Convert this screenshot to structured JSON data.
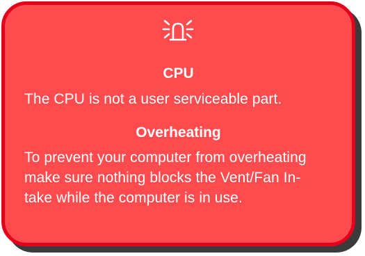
{
  "icon": "alarm-bell-icon",
  "colors": {
    "box_fill": "#ff4a4e",
    "box_border": "#e4001b",
    "shadow": "#3b3b3b",
    "text": "#ffffff"
  },
  "cpu": {
    "heading": "CPU",
    "text": "The CPU is not a user serviceable part."
  },
  "overheating": {
    "heading": "Overheating",
    "lines": [
      "To prevent your computer from overheating",
      "make sure nothing blocks the Vent/Fan In-",
      "take while the computer is in use."
    ]
  }
}
